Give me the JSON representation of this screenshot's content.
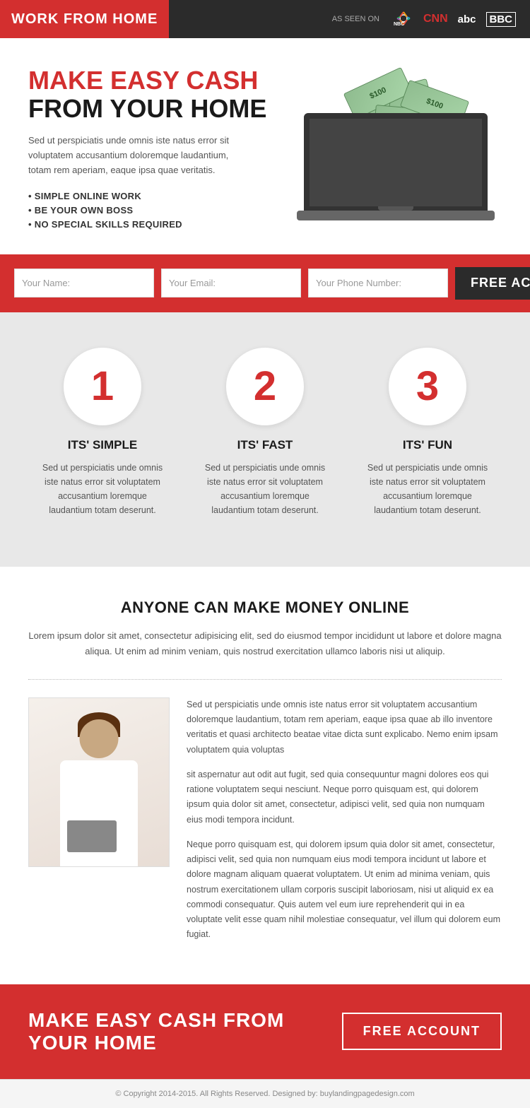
{
  "header": {
    "logo": "WORK FROM HOME",
    "as_seen_label": "AS SEEN ON",
    "networks": [
      "NBC",
      "CNN",
      "abc",
      "BBC"
    ]
  },
  "hero": {
    "title_red": "MAKE EASY CASH",
    "title_black": "FROM YOUR HOME",
    "description": "Sed ut perspiciatis unde omnis iste natus error sit voluptatem accusantium doloremque laudantium, totam rem aperiam, eaque ipsa quae veritatis.",
    "bullets": [
      "SIMPLE ONLINE WORK",
      "BE YOUR OWN BOSS",
      "NO SPECIAL SKILLS REQUIRED"
    ]
  },
  "form": {
    "name_placeholder": "Your Name:",
    "email_placeholder": "Your Email:",
    "phone_placeholder": "Your Phone Number:",
    "button_label": "FREE ACCOUNT"
  },
  "steps": [
    {
      "number": "1",
      "title": "ITS' SIMPLE",
      "desc": "Sed ut perspiciatis unde omnis iste natus error sit voluptatem accusantium loremque laudantium totam deserunt."
    },
    {
      "number": "2",
      "title": "ITS' FAST",
      "desc": "Sed ut perspiciatis unde omnis iste natus error sit voluptatem accusantium loremque laudantium totam deserunt."
    },
    {
      "number": "3",
      "title": "ITS' FUN",
      "desc": "Sed ut perspiciatis unde omnis iste natus error sit voluptatem accusantium loremque laudantium totam deserunt."
    }
  ],
  "anyone": {
    "heading": "ANYONE CAN MAKE MONEY ONLINE",
    "intro": "Lorem ipsum dolor sit amet, consectetur adipisicing elit, sed do eiusmod tempor incididunt ut labore et dolore magna aliqua. Ut enim ad minim veniam, quis nostrud exercitation ullamco laboris nisi ut aliquip.",
    "para1": "Sed ut perspiciatis unde omnis iste natus error sit voluptatem accusantium doloremque laudantium, totam rem aperiam, eaque ipsa quae ab illo inventore veritatis et quasi architecto beatae vitae dicta sunt explicabo. Nemo enim ipsam voluptatem quia voluptas",
    "para2": "sit aspernatur aut odit aut fugit, sed quia consequuntur magni dolores eos qui ratione voluptatem sequi nesciunt. Neque porro quisquam est, qui dolorem ipsum quia dolor sit amet, consectetur, adipisci velit, sed quia non numquam eius modi tempora incidunt.",
    "para3": "Neque porro quisquam est, qui dolorem ipsum quia dolor sit amet, consectetur, adipisci velit, sed quia non numquam eius modi tempora incidunt ut labore et dolore magnam aliquam quaerat voluptatem. Ut enim ad minima veniam, quis nostrum exercitationem ullam corporis suscipit laboriosam, nisi ut aliquid ex ea commodi consequatur. Quis autem vel eum iure reprehenderit qui in ea voluptate velit esse quam nihil molestiae consequatur, vel illum qui dolorem eum fugiat."
  },
  "cta": {
    "title": "MAKE EASY CASH FROM YOUR HOME",
    "button_label": "FREE ACCOUNT"
  },
  "footer": {
    "text": "© Copyright 2014-2015. All Rights Reserved. Designed by: buylandingpagedesign.com"
  }
}
